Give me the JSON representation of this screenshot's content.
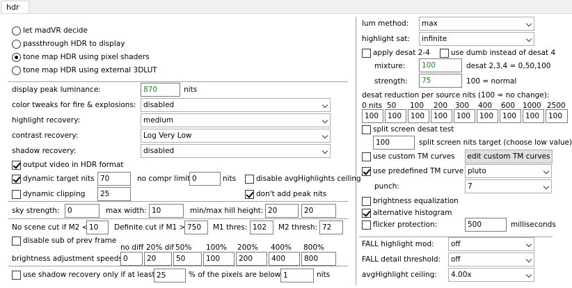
{
  "tab": {
    "label": "hdr"
  },
  "hdr_mode": {
    "options": [
      "let madVR decide",
      "passthrough HDR to display",
      "tone map HDR using pixel shaders",
      "tone map HDR using external 3DLUT"
    ],
    "selected": "tone map HDR using pixel shaders"
  },
  "peak": {
    "label": "display peak luminance:",
    "value": "870",
    "unit": "nits"
  },
  "color_tweaks": {
    "label": "color tweaks for fire & explosions:",
    "value": "disabled"
  },
  "highlight_recovery": {
    "label": "highlight recovery:",
    "value": "medium"
  },
  "contrast_recovery": {
    "label": "contrast recovery:",
    "value": "Log Very Low"
  },
  "shadow_recovery": {
    "label": "shadow recovery:",
    "value": "disabled"
  },
  "output_hdr": {
    "label": "output video in HDR format",
    "checked": true
  },
  "dynamic_target": {
    "label": "dynamic target nits",
    "checked": true,
    "value": "70"
  },
  "no_compr": {
    "label": "no compr limit:",
    "value": "0",
    "unit": "nits"
  },
  "disable_avg": {
    "label": "disable avgHighlights ceiling",
    "checked": false
  },
  "dynamic_clipping": {
    "label": "dynamic clipping",
    "checked": false,
    "value": "25"
  },
  "dont_add_peak": {
    "label": "don't add peak nits",
    "checked": true
  },
  "sky": {
    "label": "sky strength:",
    "value": "0"
  },
  "max_width": {
    "label": "max width:",
    "value": "10"
  },
  "hill": {
    "label": "min/max hill height:",
    "min": "20",
    "max": "20"
  },
  "scene_cut": {
    "label": "No scene cut if M2 <",
    "value": "10"
  },
  "definite_cut": {
    "label": "Definite cut if M1 >",
    "value": "750"
  },
  "m1_thres": {
    "label": "M1 thres:",
    "value": "102"
  },
  "m2_thresh": {
    "label": "M2 thresh:",
    "value": "72"
  },
  "disable_sub": {
    "label": "disable sub of prev frame",
    "checked": false
  },
  "brightness_speeds": {
    "label": "brightness adjustment speeds:",
    "headers": [
      "no diff",
      "20% dif",
      "50%",
      "100%",
      "200%",
      "400%",
      "800%"
    ],
    "values": [
      "0",
      "20",
      "50",
      "100",
      "200",
      "400",
      "800"
    ]
  },
  "shadow_only": {
    "label": "use shadow recovery only if at least:",
    "checked": false,
    "percent": "25",
    "middle": "% of the pixels are below",
    "nits": "1",
    "unit": "nits"
  },
  "lum_method": {
    "label": "lum method:",
    "value": "max"
  },
  "highlight_sat": {
    "label": "highlight sat:",
    "value": "infinite"
  },
  "apply_desat": {
    "label": "apply desat 2-4",
    "checked": false
  },
  "use_dumb": {
    "label": "use dumb instead of desat 4",
    "checked": false
  },
  "mixture": {
    "label": "mixture:",
    "value": "100",
    "note": "desat 2,3,4 = 0,50,100"
  },
  "strength": {
    "label": "strength:",
    "value": "75",
    "note": "100 = normal"
  },
  "desat_reduction": {
    "label": "desat reduction per source nits (100 = no change):",
    "headers": [
      "0 nits",
      "50",
      "100",
      "200",
      "300",
      "400",
      "600",
      "1000",
      "2500"
    ],
    "values": [
      "100",
      "100",
      "100",
      "100",
      "100",
      "100",
      "100",
      "100",
      "100"
    ]
  },
  "split_desat": {
    "label": "split screen desat test",
    "checked": false
  },
  "split_target": {
    "value": "100",
    "label": "split screen nits target (choose low value)"
  },
  "custom_tm": {
    "label": "use custom TM curves",
    "checked": false,
    "button": "edit custom TM curves"
  },
  "predefined_tm": {
    "label": "use predefined TM curve",
    "checked": true,
    "value": "pluto"
  },
  "punch": {
    "label": "punch:",
    "value": "7"
  },
  "brightness_eq": {
    "label": "brightness equalization",
    "checked": false
  },
  "alt_histogram": {
    "label": "alternative histogram",
    "checked": true
  },
  "flicker": {
    "label": "flicker protection:",
    "checked": false,
    "value": "500",
    "unit": "milliseconds"
  },
  "fall_highlight": {
    "label": "FALL highlight mod:",
    "value": "off"
  },
  "fall_detail": {
    "label": "FALL detail threshold:",
    "value": "off"
  },
  "avg_ceiling": {
    "label": "avgHighlight ceiling:",
    "value": "4.00x"
  }
}
